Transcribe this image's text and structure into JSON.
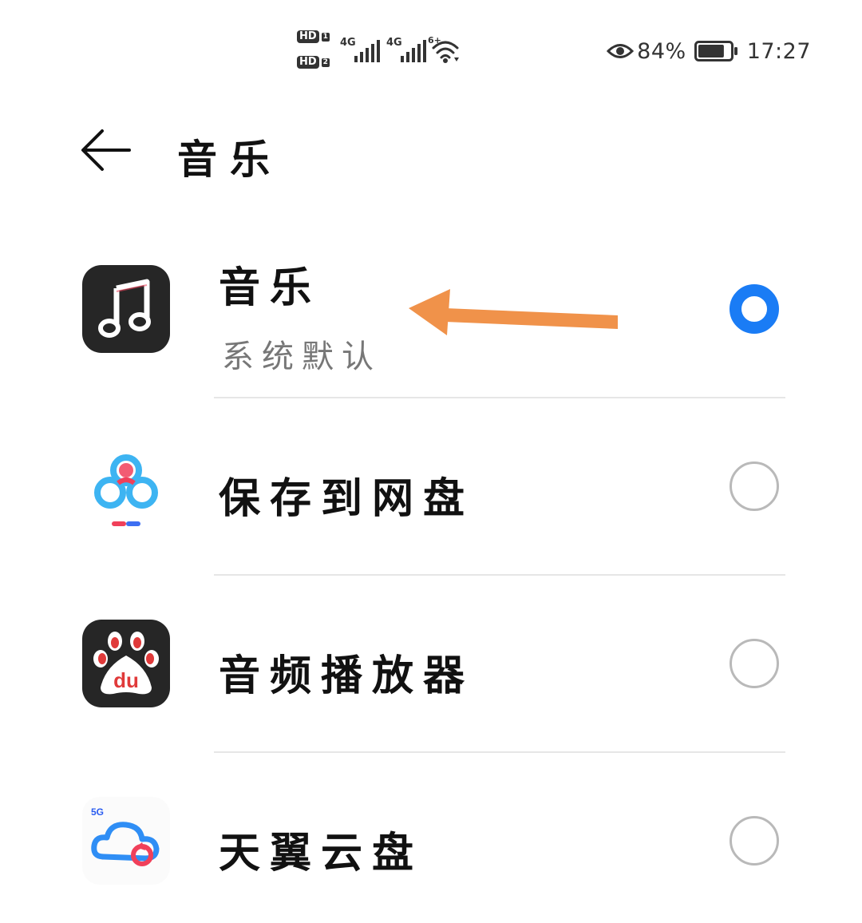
{
  "status_bar": {
    "hd_badge": "HD",
    "sim1": "1",
    "sim2": "2",
    "network1": "4G",
    "network2": "4G",
    "wifi_badge": "6+",
    "battery_percent": "84%",
    "battery_level": 0.84,
    "time": "17:27",
    "icons": [
      "eye-icon",
      "signal-icon",
      "wifi-icon",
      "battery-icon"
    ]
  },
  "header": {
    "title": "音乐"
  },
  "apps": [
    {
      "name": "音乐",
      "subtitle": "系统默认",
      "selected": true,
      "icon": "music-note-icon"
    },
    {
      "name": "保存到网盘",
      "selected": false,
      "icon": "cloud-drive-icon"
    },
    {
      "name": "音频播放器",
      "selected": false,
      "icon": "baidu-paw-icon"
    },
    {
      "name": "天翼云盘",
      "selected": false,
      "icon": "tianyi-cloud-icon",
      "icon_badge": "5G"
    }
  ],
  "colors": {
    "accent": "#1a7cf5",
    "annotation_arrow": "#f0924a",
    "divider": "#e6e6e6"
  }
}
